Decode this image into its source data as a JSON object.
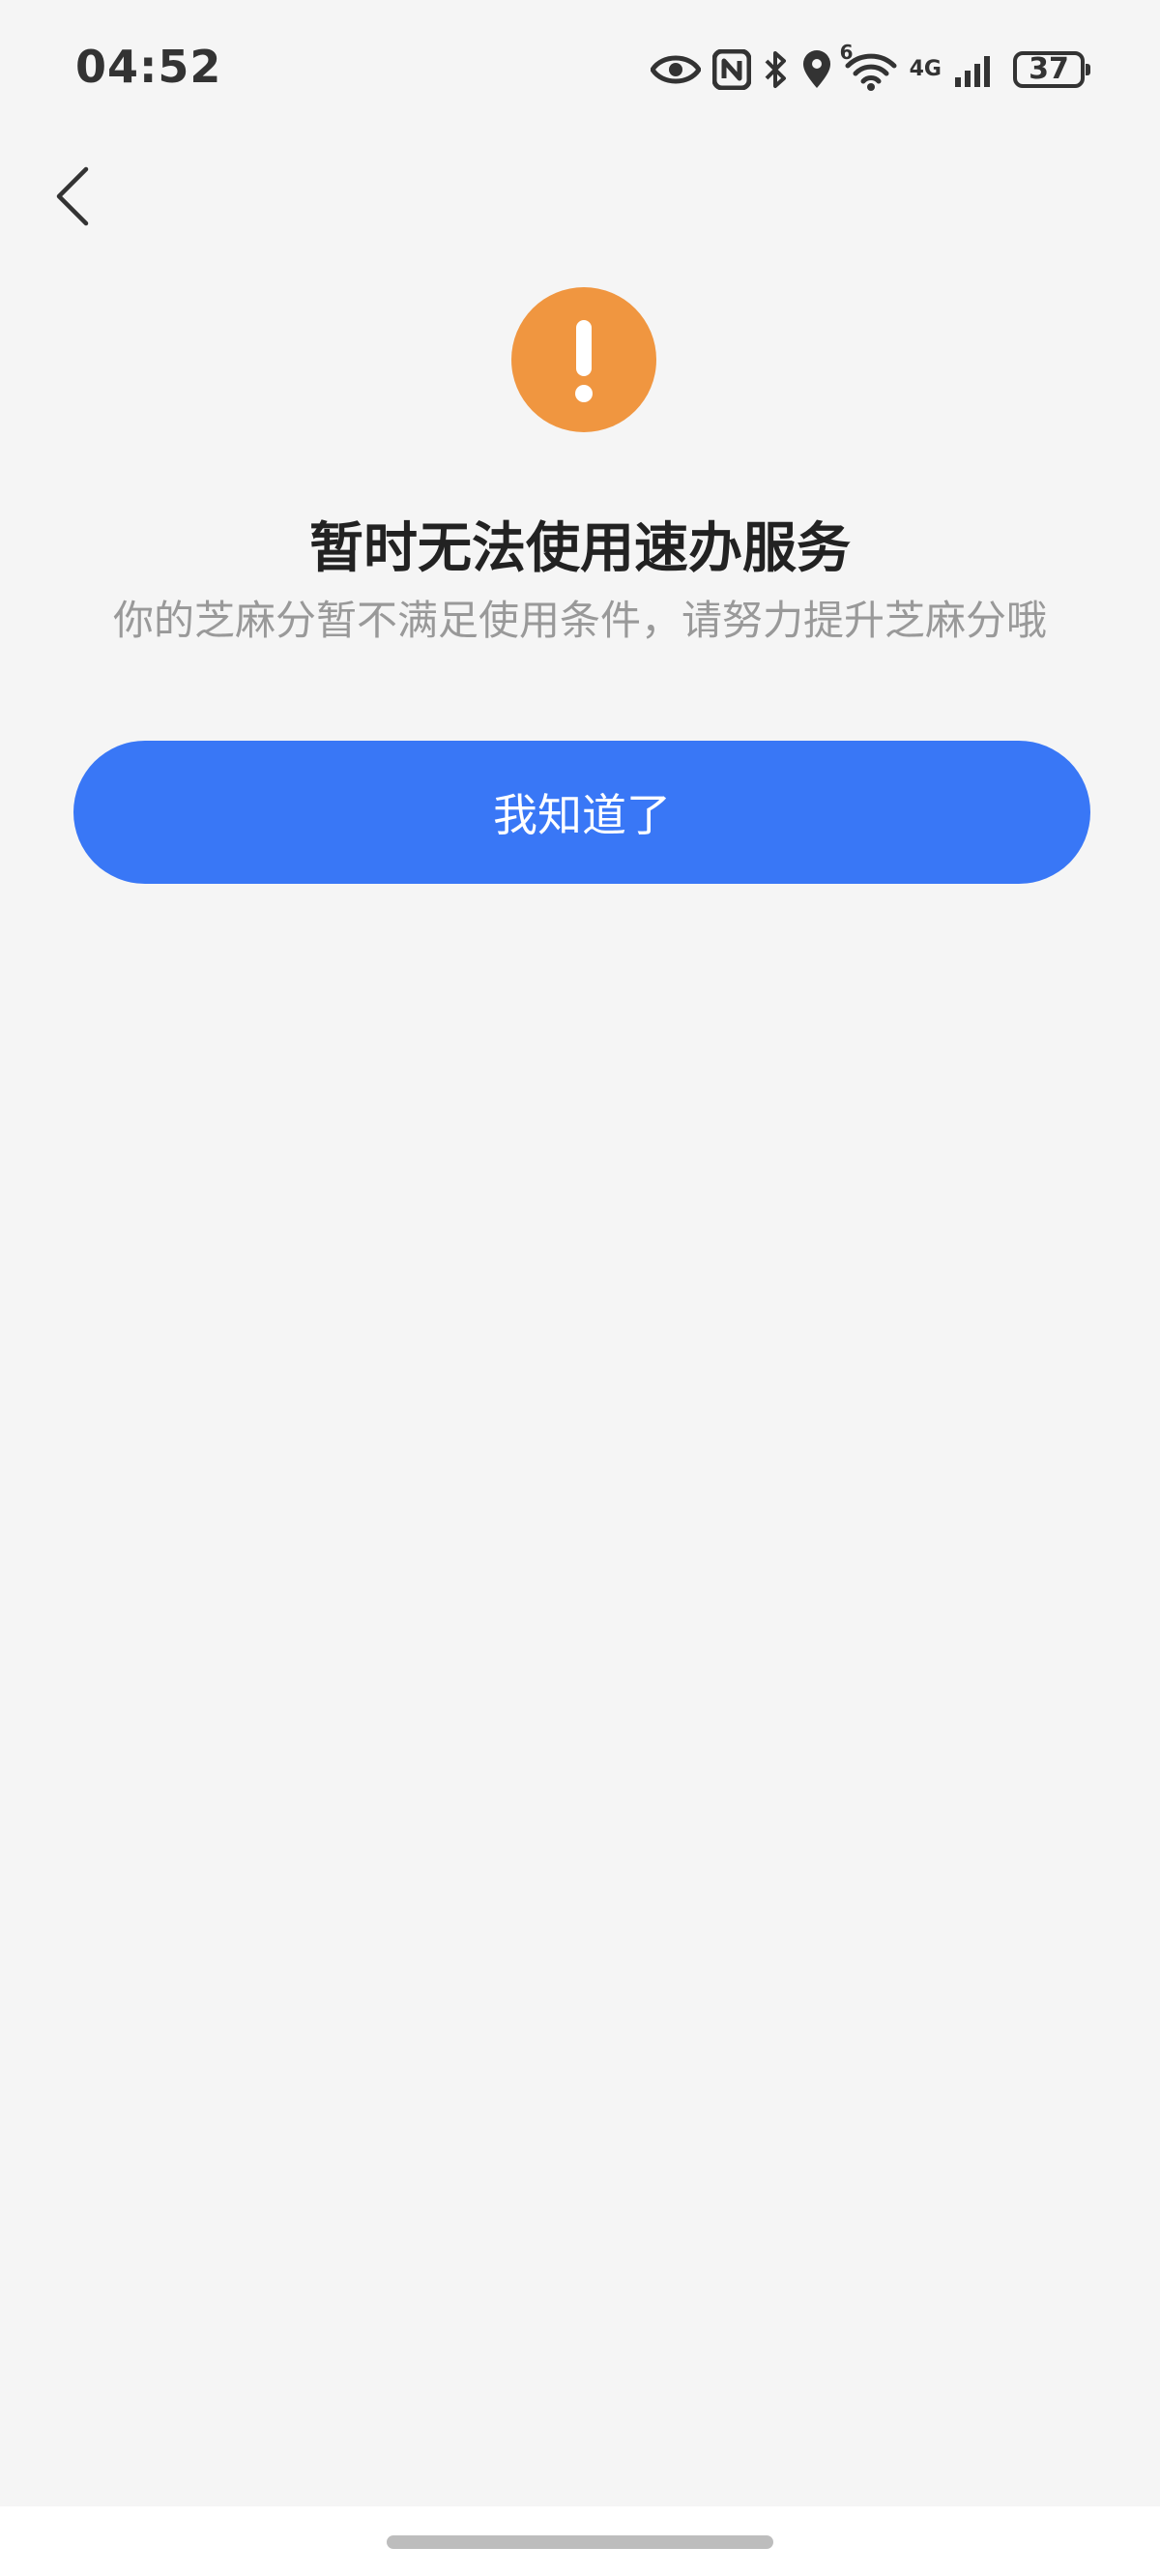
{
  "status_bar": {
    "time": "04:52",
    "wifi_badge": "6",
    "network_type": "4G",
    "battery_level": "37",
    "icons": [
      "eye-icon",
      "nfc-icon",
      "bluetooth-icon",
      "location-icon",
      "wifi-icon",
      "signal-icon",
      "battery-icon"
    ]
  },
  "nav": {
    "back_icon": "chevron-left-icon"
  },
  "content": {
    "status_icon": "exclamation-icon",
    "status_color": "#f09640",
    "title": "暂时无法使用速办服务",
    "subtitle": "你的芝麻分暂不满足使用条件，请努力提升芝麻分哦",
    "confirm_label": "我知道了"
  },
  "colors": {
    "background": "#f5f5f5",
    "accent": "#3977f6",
    "warning": "#f09640"
  }
}
